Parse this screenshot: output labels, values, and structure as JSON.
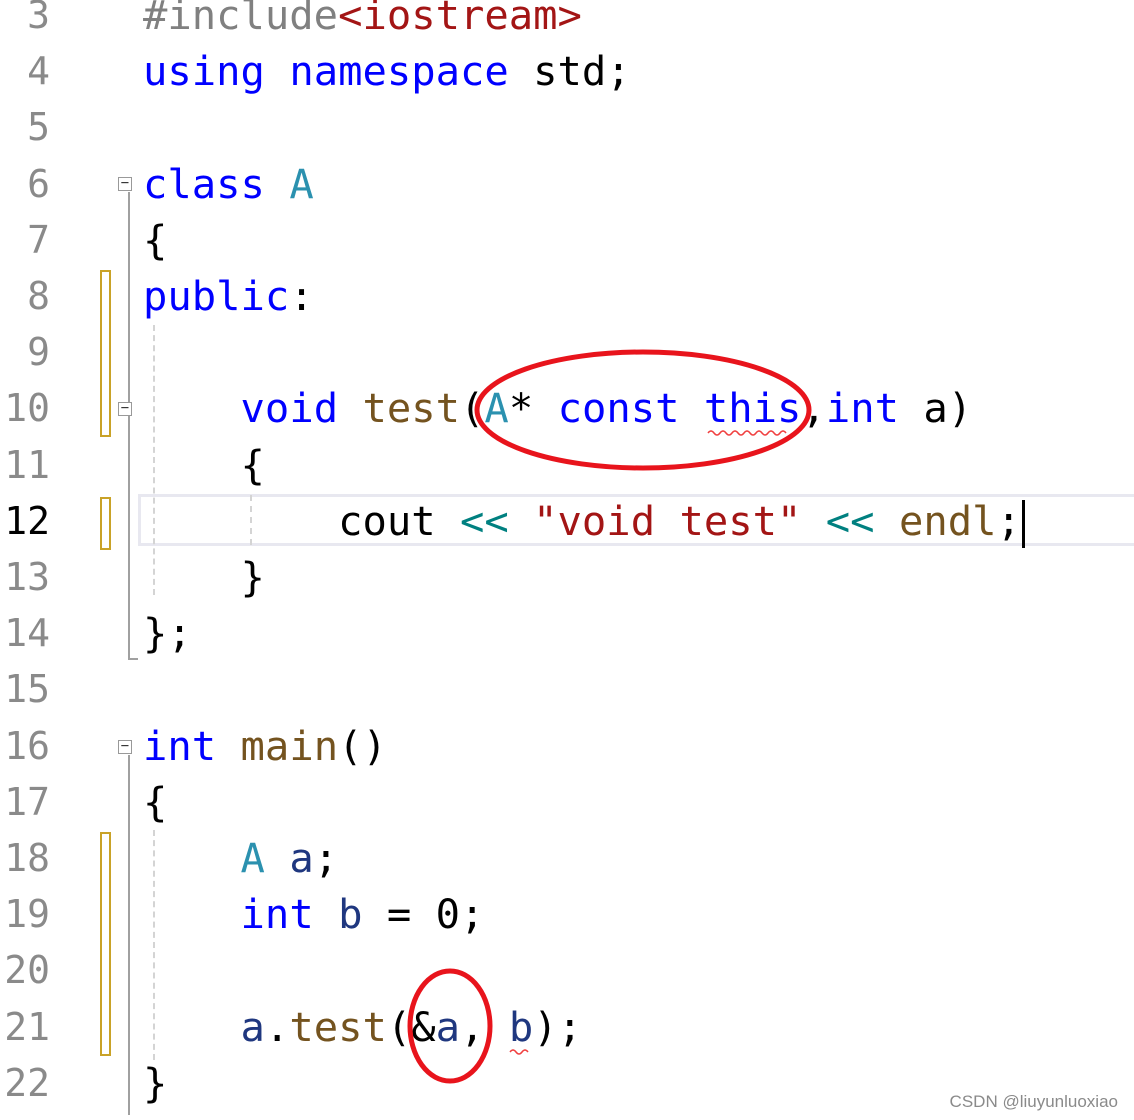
{
  "editor": {
    "current_line": 12,
    "lines": [
      {
        "n": "3",
        "tokens": [
          {
            "t": "#include",
            "c": "pp"
          },
          {
            "t": "<iostream>",
            "c": "str"
          }
        ]
      },
      {
        "n": "4",
        "tokens": [
          {
            "t": "using",
            "c": "kw"
          },
          {
            "t": " ",
            "c": "plain"
          },
          {
            "t": "namespace",
            "c": "kw"
          },
          {
            "t": " std;",
            "c": "plain"
          }
        ]
      },
      {
        "n": "5",
        "tokens": []
      },
      {
        "n": "6",
        "tokens": [
          {
            "t": "class",
            "c": "kw"
          },
          {
            "t": " ",
            "c": "plain"
          },
          {
            "t": "A",
            "c": "type"
          }
        ]
      },
      {
        "n": "7",
        "tokens": [
          {
            "t": "{",
            "c": "plain"
          }
        ]
      },
      {
        "n": "8",
        "tokens": [
          {
            "t": "public",
            "c": "kw"
          },
          {
            "t": ":",
            "c": "plain"
          }
        ]
      },
      {
        "n": "9",
        "tokens": []
      },
      {
        "n": "10",
        "tokens": [
          {
            "t": "    ",
            "c": "plain"
          },
          {
            "t": "void",
            "c": "kw"
          },
          {
            "t": " ",
            "c": "plain"
          },
          {
            "t": "test",
            "c": "fn"
          },
          {
            "t": "(",
            "c": "plain"
          },
          {
            "t": "A",
            "c": "type"
          },
          {
            "t": "* ",
            "c": "plain"
          },
          {
            "t": "const",
            "c": "kw"
          },
          {
            "t": " ",
            "c": "plain"
          },
          {
            "t": "this",
            "c": "kw"
          },
          {
            "t": ",",
            "c": "plain"
          },
          {
            "t": "int",
            "c": "kw"
          },
          {
            "t": " a)",
            "c": "plain"
          }
        ]
      },
      {
        "n": "11",
        "tokens": [
          {
            "t": "    {",
            "c": "plain"
          }
        ]
      },
      {
        "n": "12",
        "tokens": [
          {
            "t": "        cout ",
            "c": "plain"
          },
          {
            "t": "<<",
            "c": "op"
          },
          {
            "t": " ",
            "c": "plain"
          },
          {
            "t": "\"void test\"",
            "c": "str"
          },
          {
            "t": " ",
            "c": "plain"
          },
          {
            "t": "<<",
            "c": "op"
          },
          {
            "t": " ",
            "c": "plain"
          },
          {
            "t": "endl",
            "c": "fn"
          },
          {
            "t": ";",
            "c": "plain"
          }
        ]
      },
      {
        "n": "13",
        "tokens": [
          {
            "t": "    }",
            "c": "plain"
          }
        ]
      },
      {
        "n": "14",
        "tokens": [
          {
            "t": "};",
            "c": "plain"
          }
        ]
      },
      {
        "n": "15",
        "tokens": []
      },
      {
        "n": "16",
        "tokens": [
          {
            "t": "int",
            "c": "kw"
          },
          {
            "t": " ",
            "c": "plain"
          },
          {
            "t": "main",
            "c": "fn"
          },
          {
            "t": "()",
            "c": "plain"
          }
        ]
      },
      {
        "n": "17",
        "tokens": [
          {
            "t": "{",
            "c": "plain"
          }
        ]
      },
      {
        "n": "18",
        "tokens": [
          {
            "t": "    ",
            "c": "plain"
          },
          {
            "t": "A",
            "c": "type"
          },
          {
            "t": " ",
            "c": "plain"
          },
          {
            "t": "a",
            "c": "var"
          },
          {
            "t": ";",
            "c": "plain"
          }
        ]
      },
      {
        "n": "19",
        "tokens": [
          {
            "t": "    ",
            "c": "plain"
          },
          {
            "t": "int",
            "c": "kw"
          },
          {
            "t": " ",
            "c": "plain"
          },
          {
            "t": "b",
            "c": "var"
          },
          {
            "t": " = 0;",
            "c": "plain"
          }
        ]
      },
      {
        "n": "20",
        "tokens": []
      },
      {
        "n": "21",
        "tokens": [
          {
            "t": "    ",
            "c": "plain"
          },
          {
            "t": "a",
            "c": "var"
          },
          {
            "t": ".",
            "c": "plain"
          },
          {
            "t": "test",
            "c": "fn"
          },
          {
            "t": "(&",
            "c": "plain"
          },
          {
            "t": "a",
            "c": "var"
          },
          {
            "t": ", ",
            "c": "plain"
          },
          {
            "t": "b",
            "c": "var"
          },
          {
            "t": ");",
            "c": "plain"
          }
        ]
      },
      {
        "n": "22",
        "tokens": [
          {
            "t": "}",
            "c": "plain"
          }
        ]
      }
    ]
  },
  "colors": {
    "keyword": "#0000ff",
    "type": "#2b91af",
    "function": "#74531f",
    "string": "#a31515",
    "operator": "#008080",
    "annotation": "#e8141c"
  },
  "watermark": "CSDN @liuyunluoxiao"
}
